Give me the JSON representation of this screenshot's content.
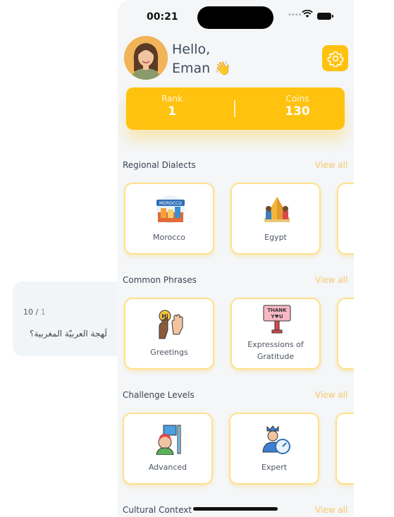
{
  "quiz": {
    "progress_current": "1",
    "progress_total": "10",
    "question": "لَهجة العربيّة المغربية؟"
  },
  "status_bar": {
    "time": "00:21"
  },
  "header": {
    "greeting_line1": "Hello,",
    "greeting_line2": "Eman 👋"
  },
  "stats": {
    "rank_label": "Rank",
    "rank_value": "1",
    "coins_label": "Coins",
    "coins_value": "130"
  },
  "sections": [
    {
      "title": "Regional Dialects",
      "view_all": "View all",
      "cards": [
        {
          "label": "Morocco",
          "icon": "morocco-landmark-icon"
        },
        {
          "label": "Egypt",
          "icon": "egypt-pyramids-icon"
        }
      ]
    },
    {
      "title": "Common Phrases",
      "view_all": "View all",
      "cards": [
        {
          "label": "Greetings",
          "icon": "waving-hands-icon"
        },
        {
          "label": "Expressions of Gratitude",
          "icon": "thank-you-sign-icon"
        }
      ]
    },
    {
      "title": "Challenge Levels",
      "view_all": "View all",
      "cards": [
        {
          "label": "Advanced",
          "icon": "student-board-icon"
        },
        {
          "label": "Expert",
          "icon": "expert-gauge-icon"
        }
      ]
    },
    {
      "title": "Cultural Context",
      "view_all": "View all",
      "cards": []
    }
  ],
  "morocco_sign": "MOROCCO",
  "thank_sign_line1": "THANK",
  "thank_sign_line2": "Y♥U",
  "greeting_bubble": "Hi",
  "colors": {
    "accent": "#ffc20e",
    "view_all": "#f6c86a",
    "background": "#f4f6f8"
  }
}
